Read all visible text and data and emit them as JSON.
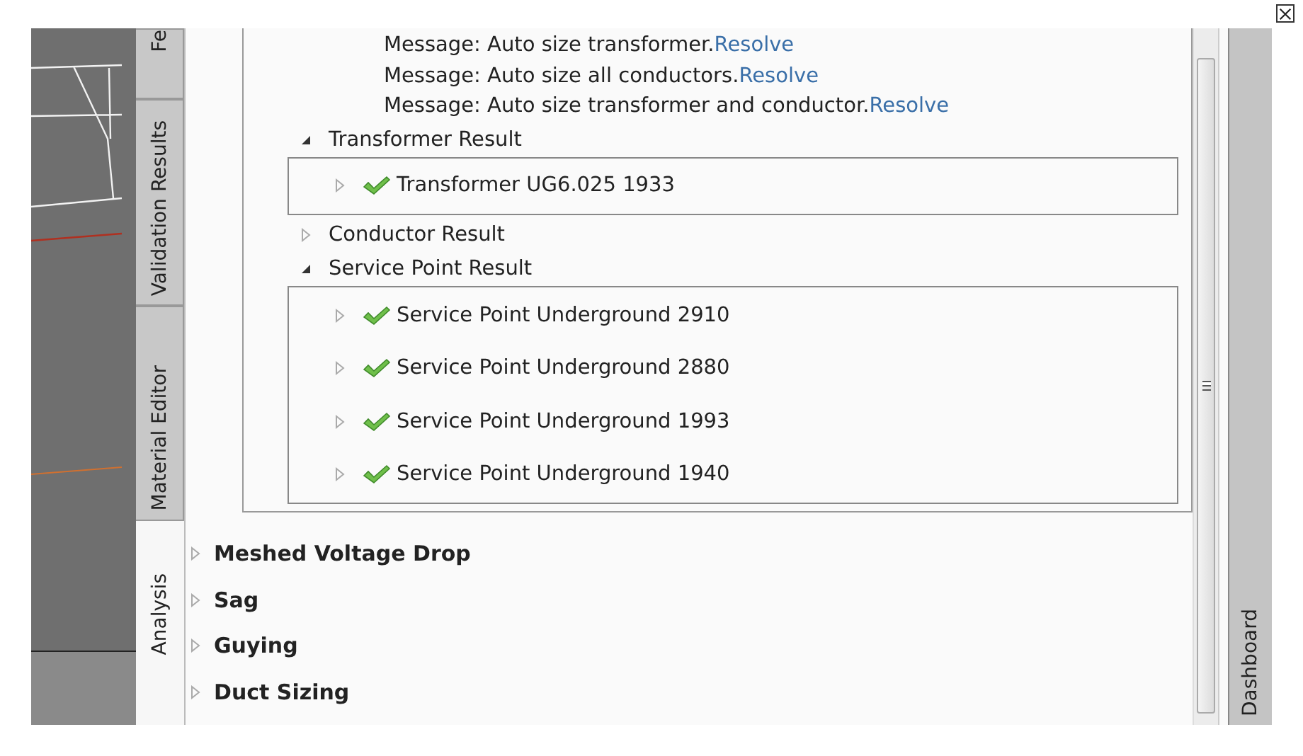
{
  "side_tabs": [
    {
      "label": "Fe",
      "selected": false
    },
    {
      "label": "Validation Results",
      "selected": false
    },
    {
      "label": "Material Editor",
      "selected": false
    },
    {
      "label": "Analysis",
      "selected": true
    }
  ],
  "messages": [
    {
      "text": "Message: Auto size transformer.",
      "link": "Resolve"
    },
    {
      "text": "Message: Auto size all conductors.",
      "link": "Resolve"
    },
    {
      "text": "Message: Auto size transformer and conductor.",
      "link": "Resolve"
    }
  ],
  "result_groups": [
    {
      "label": "Transformer Result",
      "expanded": true,
      "items": [
        {
          "label": "Transformer UG6.025 1933",
          "passed": true
        }
      ]
    },
    {
      "label": "Conductor Result",
      "expanded": false
    },
    {
      "label": "Service Point Result",
      "expanded": true,
      "items": [
        {
          "label": "Service Point Underground 2910",
          "passed": true
        },
        {
          "label": "Service Point Underground 2880",
          "passed": true
        },
        {
          "label": "Service Point Underground 1993",
          "passed": true
        },
        {
          "label": "Service Point Underground 1940",
          "passed": true
        }
      ]
    }
  ],
  "sections": [
    {
      "label": "Meshed Voltage Drop",
      "expanded": false
    },
    {
      "label": "Sag",
      "expanded": false
    },
    {
      "label": "Guying",
      "expanded": false
    },
    {
      "label": "Duct Sizing",
      "expanded": false
    }
  ],
  "right_tab": {
    "label": "Dashboard"
  }
}
